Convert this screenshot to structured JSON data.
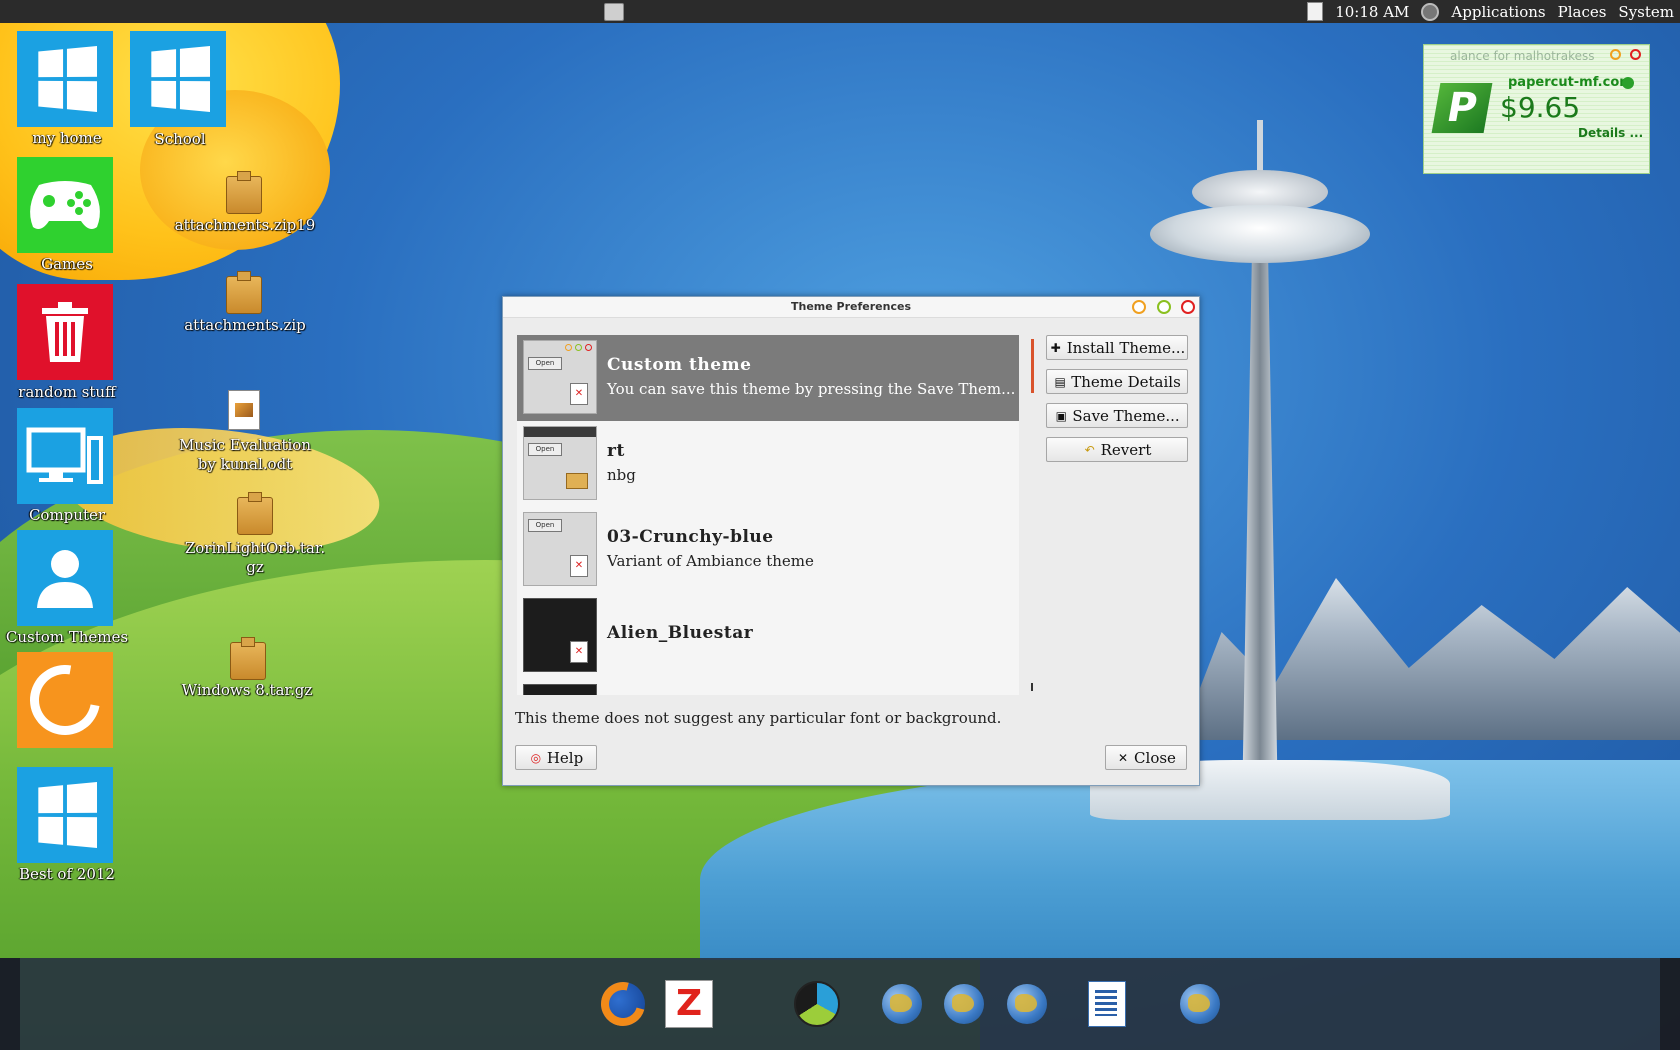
{
  "top_panel": {
    "clock": "10:18 AM",
    "menus": [
      "Applications",
      "Places",
      "System"
    ]
  },
  "desktop_icons": [
    {
      "label": "my home",
      "icon": "windows-logo-icon",
      "color": "#1ba1e2"
    },
    {
      "label": "School",
      "icon": "windows-logo-icon",
      "color": "#1ba1e2"
    },
    {
      "label": "Games",
      "icon": "gamepad-icon",
      "color": "#2fd12f"
    },
    {
      "label": "random stuff",
      "icon": "trash-icon",
      "color": "#e0112b"
    },
    {
      "label": "Computer",
      "icon": "computer-icon",
      "color": "#1ba1e2"
    },
    {
      "label": "Custom Themes",
      "icon": "user-icon",
      "color": "#1ba1e2"
    },
    {
      "label": "",
      "icon": "firefox-icon",
      "color": "#f7941d"
    },
    {
      "label": "Best of 2012",
      "icon": "windows-logo-icon",
      "color": "#1ba1e2"
    }
  ],
  "desktop_files": [
    {
      "label": "attachments.zip19",
      "icon": "archive-icon"
    },
    {
      "label": "attachments.zip",
      "icon": "archive-icon"
    },
    {
      "label": "Music Evaluation\nby kunal.odt",
      "icon": "document-icon"
    },
    {
      "label": "ZorinLightOrb.tar.\ngz",
      "icon": "archive-icon"
    },
    {
      "label": "Windows 8.tar.gz",
      "icon": "archive-icon"
    }
  ],
  "widget": {
    "title": "alance for malhotrakess",
    "site": "papercut-mf.com",
    "amount": "$9.65",
    "details": "Details ...",
    "logo_letter": "P"
  },
  "dialog": {
    "title": "Theme Preferences",
    "themes": [
      {
        "name": "Custom theme",
        "description": "You can save this theme by pressing the Save Them...",
        "selected": true
      },
      {
        "name": "rt",
        "description": "nbg",
        "selected": false
      },
      {
        "name": "03-Crunchy-blue",
        "description": "Variant of Ambiance theme",
        "selected": false
      },
      {
        "name": "Alien_Bluestar",
        "description": "",
        "selected": false
      }
    ],
    "thumb_open_label": "Open",
    "buttons": {
      "install": "Install Theme...",
      "details": "Theme Details",
      "save": "Save Theme...",
      "revert": "Revert",
      "help": "Help",
      "close": "Close"
    },
    "hint": "This theme does not suggest any particular font or background."
  },
  "dock": {
    "items": [
      "firefox-icon",
      "filezilla-icon",
      "yin-yang-app-icon",
      "globe-icon",
      "globe-icon",
      "globe-icon",
      "writer-document-icon",
      "globe-icon"
    ]
  }
}
